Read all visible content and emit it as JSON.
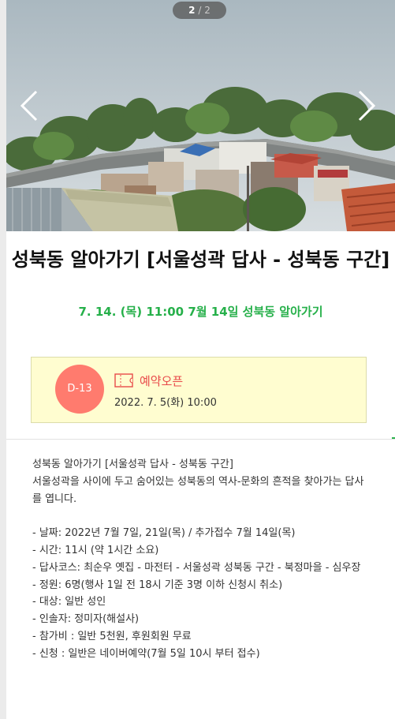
{
  "slider": {
    "current": "2",
    "separator": "/",
    "total": "2"
  },
  "event": {
    "title": "성북동 알아가기 [서울성곽 답사 - 성북동 구간]",
    "subtitle": "7. 14. (목) 11:00 7월 14일 성북동 알아가기"
  },
  "reservation": {
    "dday": "D-13",
    "status": "예약오픈",
    "open_datetime": "2022. 7. 5(화) 10:00",
    "icon": "ticket-icon"
  },
  "description": {
    "intro": [
      "성북동 알아가기 [서울성곽 답사 - 성북동 구간]",
      "서울성곽을 사이에 두고 숨어있는 성북동의 역사-문화의 흔적을 찾아가는 답사를 엽니다."
    ],
    "details": [
      "- 날짜: 2022년 7월 7일, 21일(목) / 추가접수 7월 14일(목)",
      "- 시간: 11시 (약 1시간 소요)",
      "- 답사코스: 최순우 옛집 - 마전터 - 서울성곽 성북동 구간 - 북정마을 - 심우장",
      "- 정원: 6명(행사 1일 전 18시 기준 3명 이하 신청시 취소)",
      "- 대상: 일반 성인",
      "- 인솔자: 정미자(해설사)",
      "- 참가비 : 일반 5천원, 후원회원 무료",
      "- 신청 : 일반은 네이버예약(7월 5일 10시 부터 접수)"
    ]
  },
  "colors": {
    "accent_green": "#26b04a",
    "dday_red": "#ff7b6e",
    "status_red": "#e84a4a",
    "box_yellow": "#fffdd0"
  }
}
